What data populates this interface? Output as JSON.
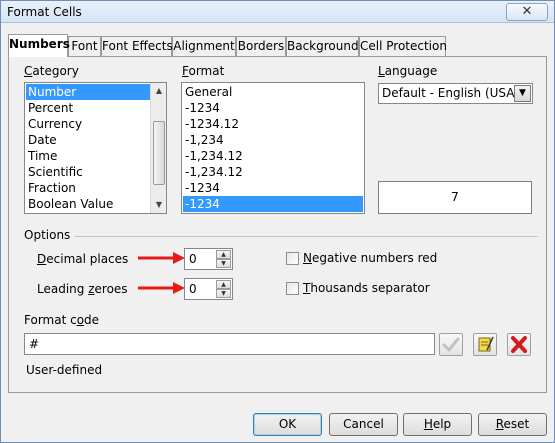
{
  "window": {
    "title": "Format Cells",
    "close_glyph": "✕"
  },
  "tabs": [
    {
      "label": "Numbers",
      "active": true
    },
    {
      "label": "Font",
      "active": false
    },
    {
      "label": "Font Effects",
      "active": false
    },
    {
      "label": "Alignment",
      "active": false
    },
    {
      "label": "Borders",
      "active": false
    },
    {
      "label": "Background",
      "active": false
    },
    {
      "label": "Cell Protection",
      "active": false
    }
  ],
  "category": {
    "label_u": "C",
    "label_rest": "ategory",
    "items": [
      "Number",
      "Percent",
      "Currency",
      "Date",
      "Time",
      "Scientific",
      "Fraction",
      "Boolean Value"
    ],
    "selected": "Number"
  },
  "format": {
    "label_u": "F",
    "label_rest": "ormat",
    "items": [
      "General",
      "-1234",
      "-1234.12",
      "-1,234",
      "-1,234.12",
      "-1,234.12",
      "-1234",
      "-1234"
    ],
    "selected_index": 7,
    "red_indices": []
  },
  "language": {
    "label_u": "L",
    "label_rest": "anguage",
    "value": "Default - English (USA)"
  },
  "preview": {
    "value": "7"
  },
  "options": {
    "label": "Options",
    "decimal_places": {
      "label_u": "D",
      "label_rest": "ecimal places",
      "value": "0"
    },
    "leading_zeroes": {
      "label_pre": "Leading ",
      "label_u": "z",
      "label_rest": "eroes",
      "value": "0"
    },
    "negative_red": {
      "label_u": "N",
      "label_rest": "egative numbers red",
      "checked": false
    },
    "thousands": {
      "label_u": "T",
      "label_rest": "housands separator",
      "checked": false
    }
  },
  "format_code": {
    "label_pre": "Format c",
    "label_u": "o",
    "label_rest": "de",
    "value": "#",
    "description": "User-defined"
  },
  "buttons": {
    "ok": "OK",
    "cancel": "Cancel",
    "help_u": "H",
    "help_rest": "elp",
    "reset_u": "R",
    "reset_rest": "eset"
  },
  "colors": {
    "annotation_arrow": "#e8191a",
    "selection": "#3399ff",
    "delete_icon": "#d41c1c"
  }
}
